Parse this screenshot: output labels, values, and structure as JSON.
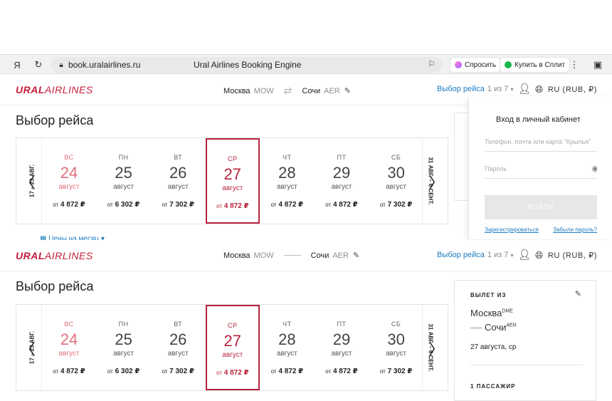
{
  "browser": {
    "url": "book.uralairlines.ru",
    "page_title": "Ural Airlines Booking Engine",
    "ask_button": "Спросить",
    "split_button": "Купить в Сплит"
  },
  "header": {
    "logo_bold": "URAL",
    "logo_rest": "AIRLINES",
    "from_city": "Москва",
    "from_code": "MOW",
    "to_city": "Сочи",
    "to_code": "AER",
    "flight_choice": "Выбор рейса",
    "step_count": "1 из 7",
    "lang": "RU (RUB, ₽)"
  },
  "main": {
    "title": "Выбор рейса",
    "left_range": "17 – 23 АВГ.",
    "right_range": "31 АВГ. – 6 СЕНТ.",
    "month_price_link": "Цены на месяц",
    "days": [
      {
        "dow": "ВС",
        "num": "24",
        "month": "август",
        "price_prefix": "от",
        "price": "4 872 ₽",
        "style": "red"
      },
      {
        "dow": "ПН",
        "num": "25",
        "month": "август",
        "price_prefix": "от",
        "price": "6 302 ₽",
        "style": ""
      },
      {
        "dow": "ВТ",
        "num": "26",
        "month": "август",
        "price_prefix": "от",
        "price": "7 302 ₽",
        "style": ""
      },
      {
        "dow": "СР",
        "num": "27",
        "month": "август",
        "price_prefix": "от",
        "price": "4 872 ₽",
        "style": "selected"
      },
      {
        "dow": "ЧТ",
        "num": "28",
        "month": "август",
        "price_prefix": "от",
        "price": "4 872 ₽",
        "style": ""
      },
      {
        "dow": "ПТ",
        "num": "29",
        "month": "август",
        "price_prefix": "от",
        "price": "4 872 ₽",
        "style": ""
      },
      {
        "dow": "СБ",
        "num": "30",
        "month": "август",
        "price_prefix": "от",
        "price": "7 302 ₽",
        "style": ""
      }
    ]
  },
  "login": {
    "title": "Вход в личный кабинет",
    "login_placeholder": "Телефон, почта или карта \"Крылья\"",
    "password_placeholder": "Пароль",
    "button": "ВОЙТИ",
    "register": "Зарегистрироваться",
    "forgot": "Забыли пароль?"
  },
  "summary": {
    "label": "ВЫЛЕТ ИЗ",
    "from_city": "Москва",
    "from_code": "DME",
    "to_city": "Сочи",
    "to_code": "AER",
    "date": "27 августа, ср",
    "passengers": "1 ПАССАЖИР"
  }
}
